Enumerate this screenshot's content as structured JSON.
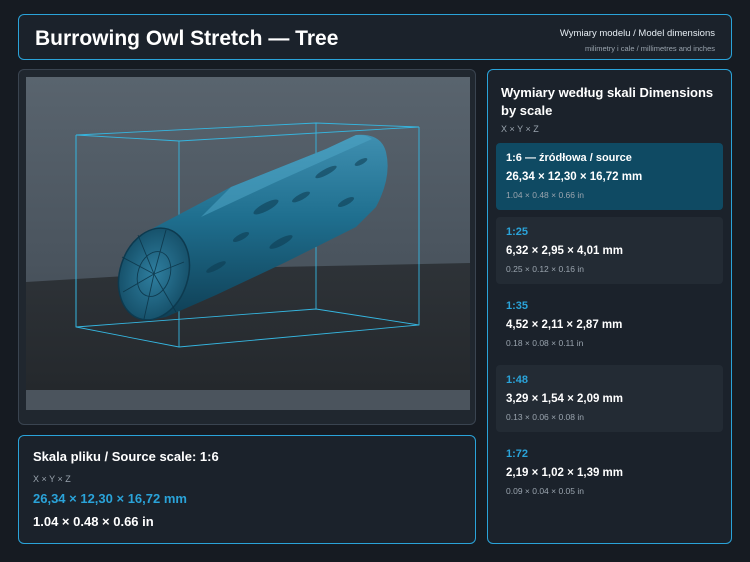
{
  "header": {
    "title": "Burrowing Owl Stretch — Tree",
    "subtitle": "Wymiary modelu / Model dimensions",
    "units_note": "milimetry i cale / millimetres and inches"
  },
  "viewer": {
    "model_icon": "log-model-icon"
  },
  "source": {
    "title": "Skala pliku / Source scale: 1:6",
    "axes": "X × Y × Z",
    "mm": "26,34 × 12,30 × 16,72 mm",
    "inches": "1.04 × 0.48 × 0.66 in"
  },
  "scales": {
    "title": "Wymiary według skali Dimensions by scale",
    "axes": "X × Y × Z",
    "items": [
      {
        "label": "1:6  —  źródłowa / source",
        "mm": "26,34 × 12,30 × 16,72 mm",
        "inches": "1.04 × 0.48 × 0.66 in"
      },
      {
        "label": "1:25",
        "mm": "6,32 × 2,95 × 4,01 mm",
        "inches": "0.25 × 0.12 × 0.16 in"
      },
      {
        "label": "1:35",
        "mm": "4,52 × 2,11 × 2,87 mm",
        "inches": "0.18 × 0.08 × 0.11 in"
      },
      {
        "label": "1:48",
        "mm": "3,29 × 1,54 × 2,09 mm",
        "inches": "0.13 × 0.06 × 0.08 in"
      },
      {
        "label": "1:72",
        "mm": "2,19 × 1,02 × 1,39 mm",
        "inches": "0.09 × 0.04 × 0.05 in"
      }
    ]
  },
  "colors": {
    "accent": "#2aa3d9",
    "background": "#161b22",
    "active_item": "#0f4a63",
    "model": "#1f6f8f"
  }
}
